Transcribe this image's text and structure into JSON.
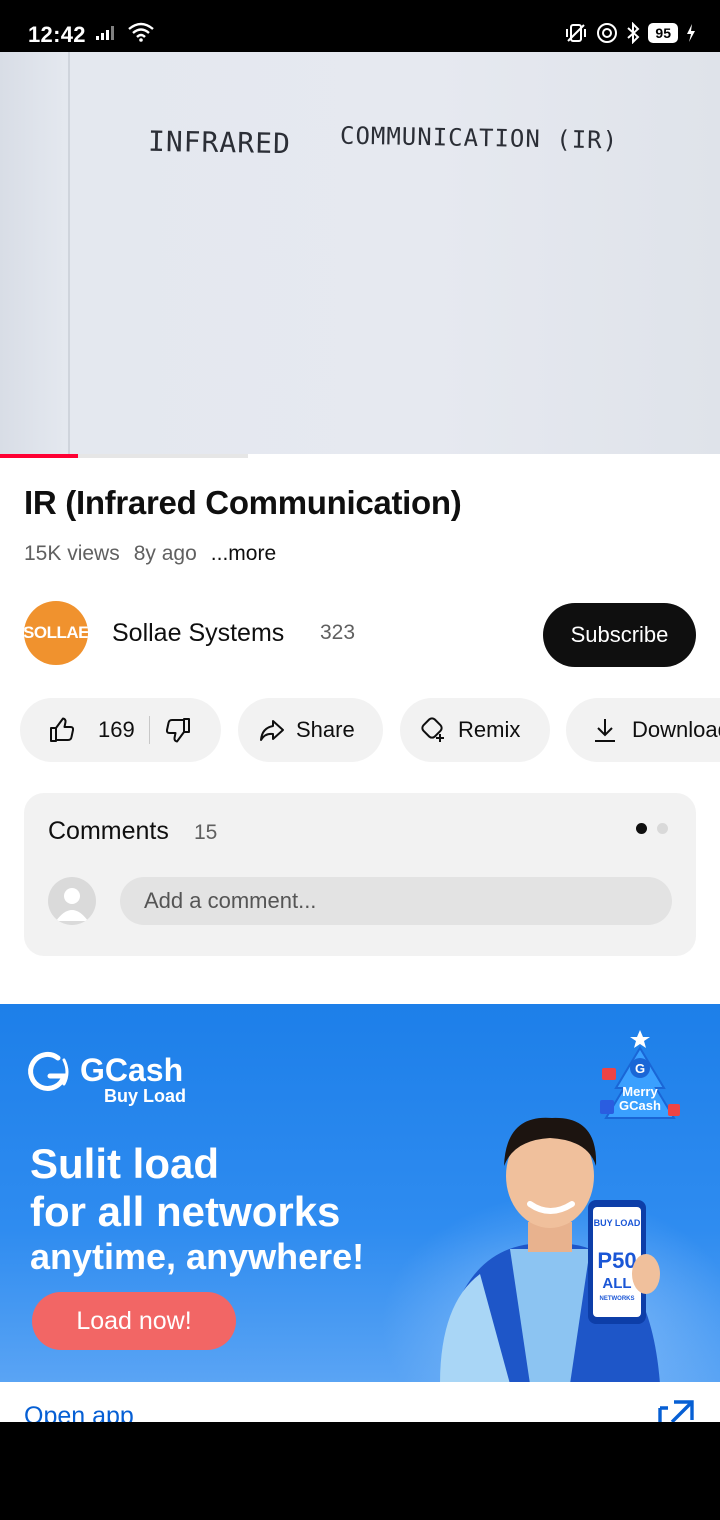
{
  "status_bar": {
    "time": "12:42",
    "battery": "95",
    "icons": [
      "signal-icon",
      "wifi-icon",
      "vibrate-icon",
      "sync-icon",
      "bluetooth-icon",
      "battery-icon",
      "charging-icon"
    ]
  },
  "video": {
    "handwriting_left": "INFRARED",
    "handwriting_right": "COMMUNICATION (IR)",
    "progress_played_fraction": 0.108,
    "progress_buffered_fraction": 0.344
  },
  "details": {
    "title": "IR (Infrared Communication)",
    "views": "15K views",
    "age": "8y ago",
    "more": "...more"
  },
  "channel": {
    "avatar_text": "SOLLAE",
    "name": "Sollae Systems",
    "subscribers": "323",
    "subscribe_label": "Subscribe"
  },
  "actions": {
    "like_count": "169",
    "share_label": "Share",
    "remix_label": "Remix",
    "download_label": "Download"
  },
  "comments": {
    "title": "Comments",
    "count": "15",
    "placeholder": "Add a comment..."
  },
  "ad": {
    "brand": "GCash",
    "brand_sub": "Buy Load",
    "headline_line1": "Sulit load",
    "headline_line2": "for all networks",
    "headline_line3": "anytime, anywhere!",
    "cta": "Load now!",
    "badge_line1": "Merry",
    "badge_line2": "GCash",
    "phone_label": "BUY LOAD",
    "phone_price": "P50",
    "phone_all": "ALL",
    "phone_networks": "NETWORKS",
    "colors": {
      "background": "#2f8cf0",
      "cta": "#f26665"
    }
  },
  "open_app": {
    "label": "Open app"
  }
}
